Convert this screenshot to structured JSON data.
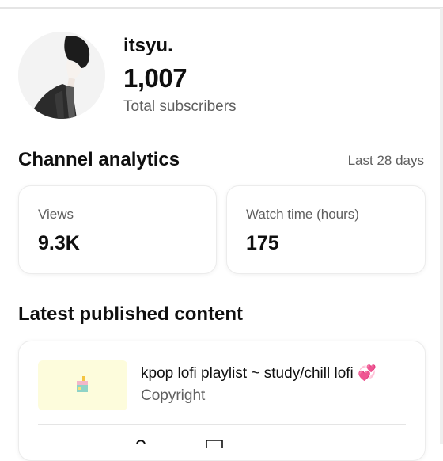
{
  "channel": {
    "name": "itsyu.",
    "subscribers": "1,007",
    "subscribers_label": "Total subscribers"
  },
  "analytics": {
    "title": "Channel analytics",
    "period": "Last 28 days",
    "metrics": [
      {
        "label": "Views",
        "value": "9.3K"
      },
      {
        "label": "Watch time (hours)",
        "value": "175"
      }
    ]
  },
  "latest": {
    "title": "Latest published content",
    "video": {
      "title": "kpop lofi playlist ~ study/chill lofi",
      "emoji": "💞",
      "status": "Copyright"
    }
  },
  "colors": {
    "text_primary": "#0f0f0f",
    "text_secondary": "#5f5f5f",
    "thumbnail_bg": "#fdfcdc",
    "emoji_heart": "#e05fd0"
  }
}
